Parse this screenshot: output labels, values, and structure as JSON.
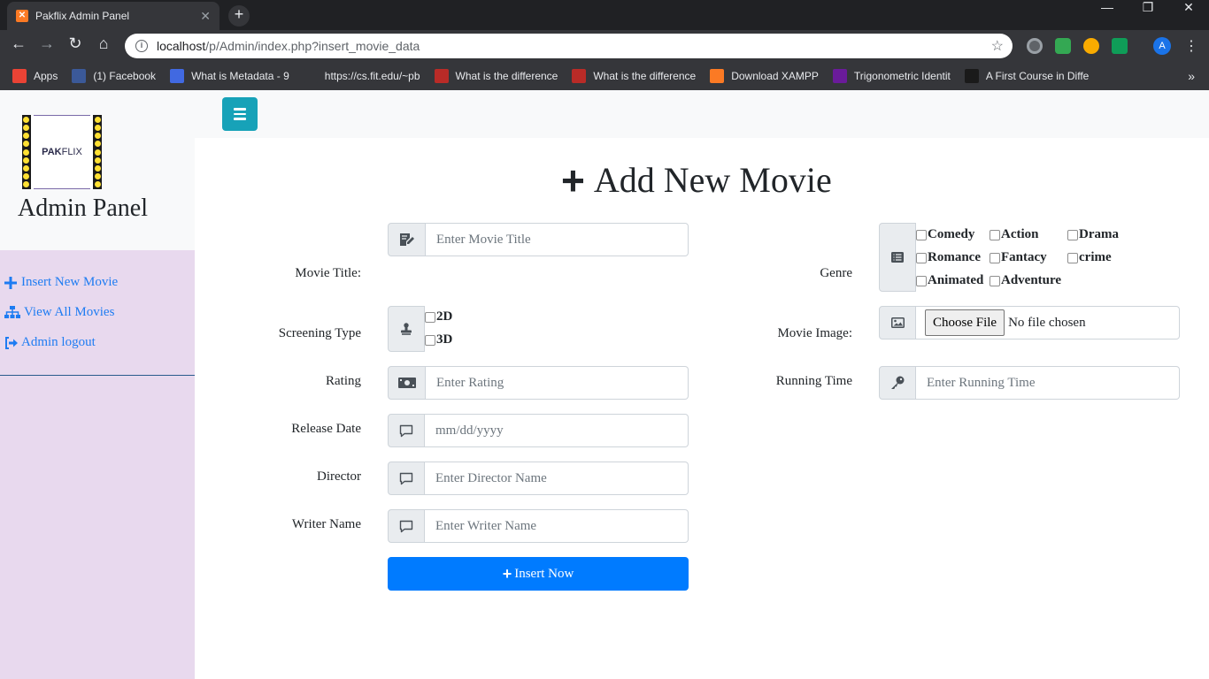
{
  "browser": {
    "tab_title": "Pakflix Admin Panel",
    "url_host": "localhost",
    "url_path": "/p/Admin/index.php?insert_movie_data",
    "profile_initial": "A",
    "bookmarks": [
      {
        "label": "Apps",
        "icon": "apps-grid-icon",
        "color": "#ea4335"
      },
      {
        "label": "(1) Facebook",
        "icon": "facebook-icon",
        "color": "#3b5998"
      },
      {
        "label": "What is Metadata - 9",
        "icon": "doc-icon",
        "color": "#4169e1"
      },
      {
        "label": "https://cs.fit.edu/~pb",
        "icon": "page-icon",
        "color": "#35363a"
      },
      {
        "label": "What is the difference",
        "icon": "quora-icon",
        "color": "#b92b27"
      },
      {
        "label": "What is the difference",
        "icon": "quora-icon",
        "color": "#b92b27"
      },
      {
        "label": "Download XAMPP",
        "icon": "xampp-icon",
        "color": "#fb7a24"
      },
      {
        "label": "Trigonometric Identit",
        "icon": "pm-icon",
        "color": "#6a1b9a"
      },
      {
        "label": "A First Course in Diffe",
        "icon": "scribd-icon",
        "color": "#1a1a1a"
      }
    ]
  },
  "sidebar": {
    "logo_text_bold": "PAK",
    "logo_text_light": "FLIX",
    "title": "Admin Panel",
    "items": [
      {
        "label": "Insert New Movie",
        "icon": "plus-icon"
      },
      {
        "label": "View All Movies",
        "icon": "sitemap-icon"
      },
      {
        "label": "Admin logout",
        "icon": "sign-out-icon"
      }
    ]
  },
  "page": {
    "heading": "Add New Movie"
  },
  "form": {
    "title_label": "Movie Title:",
    "title_placeholder": "Enter Movie Title",
    "genre_label": "Genre",
    "genres": [
      "Comedy",
      "Action",
      "Drama",
      "Romance",
      "Fantacy",
      "crime",
      "Animated",
      "Adventure"
    ],
    "screening_label": "Screening Type",
    "screening_options": [
      "2D",
      "3D"
    ],
    "image_label": "Movie Image:",
    "file_button": "Choose File",
    "file_status": "No file chosen",
    "rating_label": "Rating",
    "rating_placeholder": "Enter Rating",
    "running_label": "Running Time",
    "running_placeholder": "Enter Running Time",
    "release_label": "Release Date",
    "release_placeholder": "mm/dd/yyyy",
    "director_label": "Director",
    "director_placeholder": "Enter Director Name",
    "writer_label": "Writer Name",
    "writer_placeholder": "Enter Writer Name",
    "submit_label": "Insert Now"
  },
  "colors": {
    "sidebar_bg": "#e8d9ee",
    "link": "#1e7cf2",
    "primary": "#007bff",
    "toggle": "#17a2b8"
  }
}
